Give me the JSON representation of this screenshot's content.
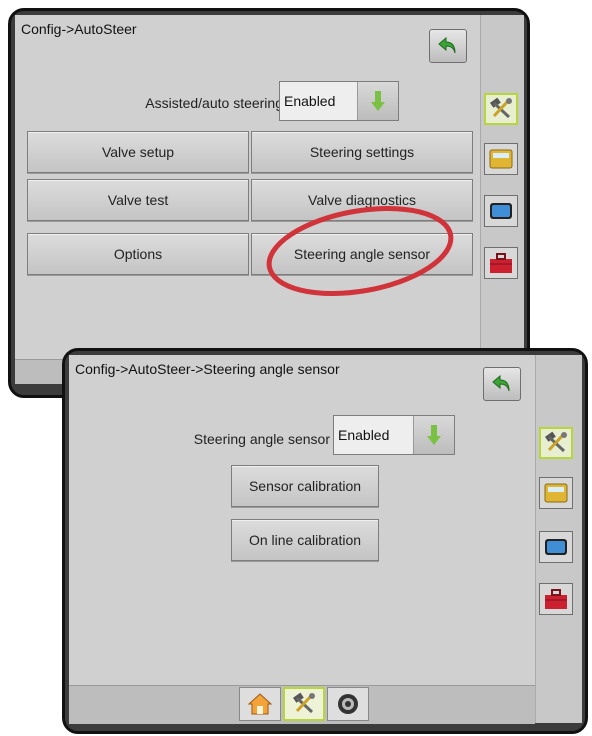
{
  "screen1": {
    "breadcrumb": "Config->AutoSteer",
    "assisted": {
      "label": "Assisted/auto steering",
      "value": "Enabled"
    },
    "buttons": {
      "valve_setup": "Valve setup",
      "steering_settings": "Steering settings",
      "valve_test": "Valve test",
      "valve_diagnostics": "Valve diagnostics",
      "options": "Options",
      "steering_angle_sensor": "Steering angle sensor"
    }
  },
  "screen2": {
    "breadcrumb": "Config->AutoSteer->Steering angle sensor",
    "sensor": {
      "label": "Steering angle sensor",
      "value": "Enabled"
    },
    "buttons": {
      "sensor_calibration": "Sensor calibration",
      "online_calibration": "On line calibration"
    }
  },
  "side_tabs": [
    "tools-icon",
    "console-icon",
    "screen-icon",
    "toolbox-icon"
  ],
  "bottom_tabs": [
    "home-icon",
    "tools-icon",
    "gnss-icon"
  ],
  "colors": {
    "highlight_ring": "#d0343a",
    "active_border": "#b9d53d",
    "arrow_green": "#7ac143",
    "toolbox_red": "#cc2030",
    "console_yellow": "#e0b534",
    "screen_blue": "#3f8ed6"
  }
}
